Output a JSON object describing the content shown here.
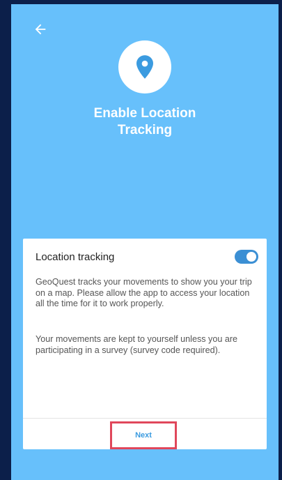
{
  "header": {
    "back_icon": "arrow-left-icon",
    "logo_icon": "location-pin-icon",
    "title_line1": "Enable Location",
    "title_line2": "Tracking"
  },
  "card": {
    "title": "Location tracking",
    "toggle_on": true,
    "paragraph1": "GeoQuest tracks your movements to show you your trip on a map. Please allow the app to access your location all the time for it to work properly.",
    "paragraph2": "Your movements are kept to yourself unless you are participating in a survey (survey code required).",
    "next_label": "Next"
  },
  "colors": {
    "background": "#67c0fb",
    "frame": "#0c1f4a",
    "accent": "#3b8fd4",
    "highlight": "#e0475b"
  }
}
